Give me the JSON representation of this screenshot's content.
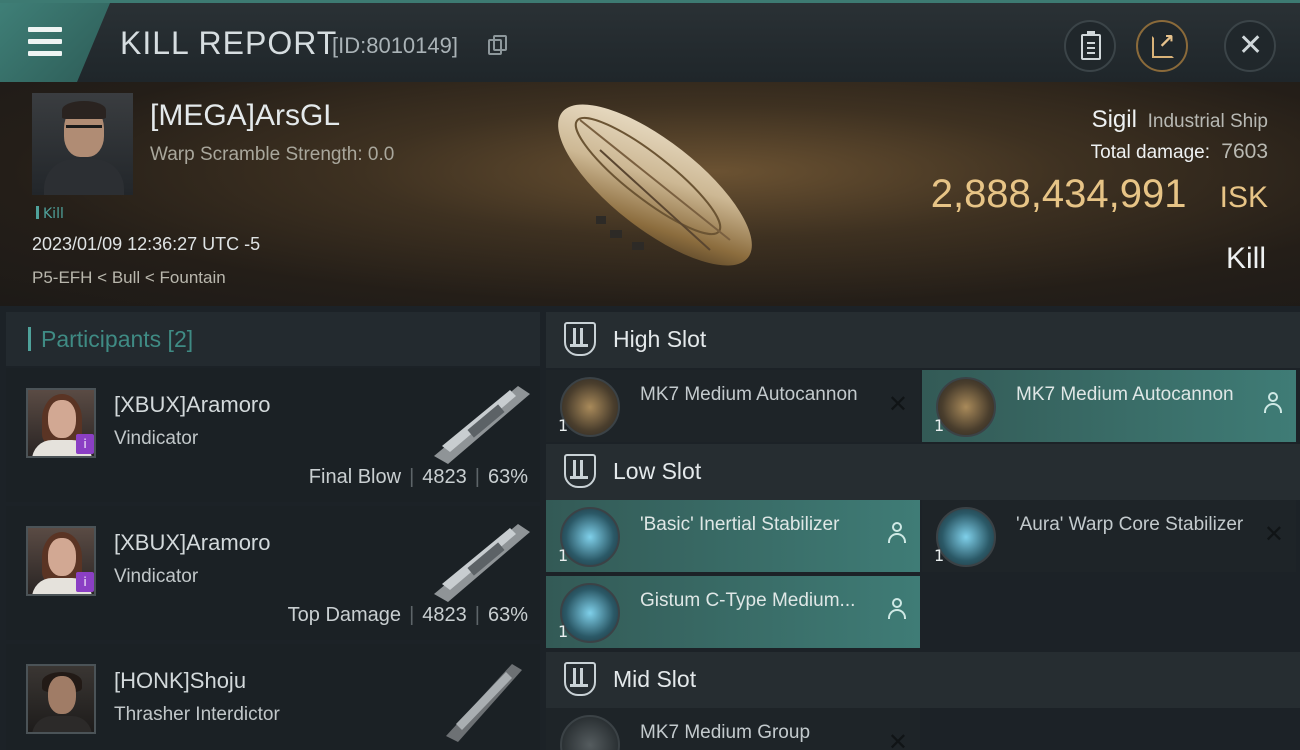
{
  "header": {
    "title": "KILL REPORT",
    "report_id": "[ID:8010149]"
  },
  "victim": {
    "name": "[MEGA]ArsGL",
    "warp_scramble": "Warp Scramble Strength: 0.0",
    "kill_tag": "Kill",
    "datetime": "2023/01/09 12:36:27 UTC -5",
    "location": "P5-EFH < Bull < Fountain",
    "ship_name": "Sigil",
    "ship_class": "Industrial Ship",
    "total_damage_label": "Total damage:",
    "total_damage": "7603",
    "isk_value": "2,888,434,991",
    "isk_unit": "ISK",
    "result": "Kill"
  },
  "participants": {
    "label": "Participants [2]",
    "items": [
      {
        "name": "[XBUX]Aramoro",
        "ship": "Vindicator",
        "role": "Final Blow",
        "damage": "4823",
        "percent": "63%"
      },
      {
        "name": "[XBUX]Aramoro",
        "ship": "Vindicator",
        "role": "Top Damage",
        "damage": "4823",
        "percent": "63%"
      },
      {
        "name": "[HONK]Shoju",
        "ship": "Thrasher Interdictor",
        "role": "",
        "damage": "",
        "percent": ""
      }
    ]
  },
  "fitting": {
    "high_slot": {
      "label": "High Slot",
      "modules": [
        {
          "qty": "1",
          "name": "MK7 Medium Autocannon",
          "status": "destroyed"
        },
        {
          "qty": "1",
          "name": "MK7 Medium Autocannon",
          "status": "dropped"
        }
      ]
    },
    "low_slot": {
      "label": "Low Slot",
      "modules": [
        {
          "qty": "1",
          "name": "'Basic' Inertial Stabilizer",
          "status": "dropped"
        },
        {
          "qty": "1",
          "name": "'Aura' Warp Core Stabilizer",
          "status": "destroyed"
        },
        {
          "qty": "1",
          "name": "Gistum C-Type Medium...",
          "status": "dropped"
        }
      ]
    },
    "mid_slot": {
      "label": "Mid Slot",
      "modules": [
        {
          "qty": "1",
          "name": "MK7 Medium Group",
          "status": "destroyed"
        }
      ]
    }
  },
  "colors": {
    "accent_teal": "#4fa29b",
    "isk_gold": "#e7c486",
    "dropped_bg": "#3f7c76"
  },
  "icons": [
    "menu-icon",
    "copy-icon",
    "clipboard-icon",
    "share-icon",
    "close-icon",
    "slot-icon",
    "person-icon",
    "destroyed-x-icon"
  ]
}
